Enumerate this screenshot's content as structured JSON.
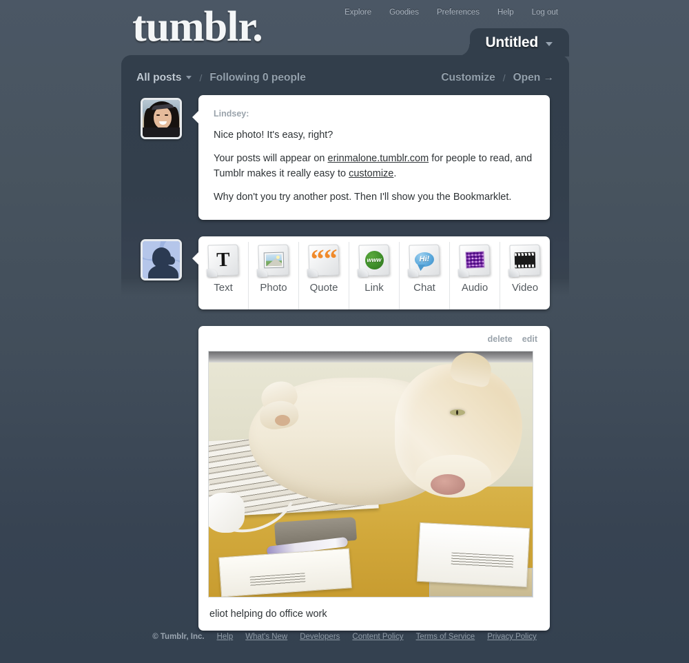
{
  "header": {
    "logo": "tumblr.",
    "nav": [
      {
        "label": "Explore"
      },
      {
        "label": "Goodies"
      },
      {
        "label": "Preferences"
      },
      {
        "label": "Help"
      },
      {
        "label": "Log out"
      }
    ],
    "blog_tab": {
      "title": "Untitled"
    }
  },
  "subnav": {
    "all_posts": "All posts",
    "separator": "/",
    "following": "Following 0 people",
    "customize": "Customize",
    "open": "Open →"
  },
  "message": {
    "author": "Lindsey:",
    "line1": "Nice photo! It's easy, right?",
    "line2_a": "Your posts will appear on ",
    "line2_link": "erinmalone.tumblr.com",
    "line2_b": " for people to read, and Tumblr makes it really easy to ",
    "line2_link2": "customize",
    "line2_c": ".",
    "line3": "Why don't you try another post. Then I'll show you the Bookmarklet."
  },
  "post_types": [
    {
      "label": "Text",
      "icon": "text-note-icon",
      "glyph": "T"
    },
    {
      "label": "Photo",
      "icon": "photo-note-icon",
      "glyph": ""
    },
    {
      "label": "Quote",
      "icon": "quote-note-icon",
      "glyph": "““"
    },
    {
      "label": "Link",
      "icon": "link-note-icon",
      "glyph": "www"
    },
    {
      "label": "Chat",
      "icon": "chat-note-icon",
      "glyph": "Hi!"
    },
    {
      "label": "Audio",
      "icon": "audio-note-icon",
      "glyph": ""
    },
    {
      "label": "Video",
      "icon": "video-note-icon",
      "glyph": ""
    }
  ],
  "photo_post": {
    "delete": "delete",
    "edit": "edit",
    "caption": "eliot helping do office work",
    "image_alt": "cream cat lying across papers on a yellow office desk"
  },
  "footer": {
    "copyright": "© Tumblr, Inc.",
    "links": [
      {
        "label": "Help"
      },
      {
        "label": "What's New"
      },
      {
        "label": "Developers"
      },
      {
        "label": "Content Policy"
      },
      {
        "label": "Terms of Service"
      },
      {
        "label": "Privacy Policy"
      }
    ]
  },
  "colors": {
    "page_bg_top": "#4b5765",
    "page_bg_bottom": "#344150",
    "panel": "#323e4b",
    "card": "#ffffff",
    "text_dark": "#2e3336",
    "text_muted": "#9aa3ab"
  }
}
